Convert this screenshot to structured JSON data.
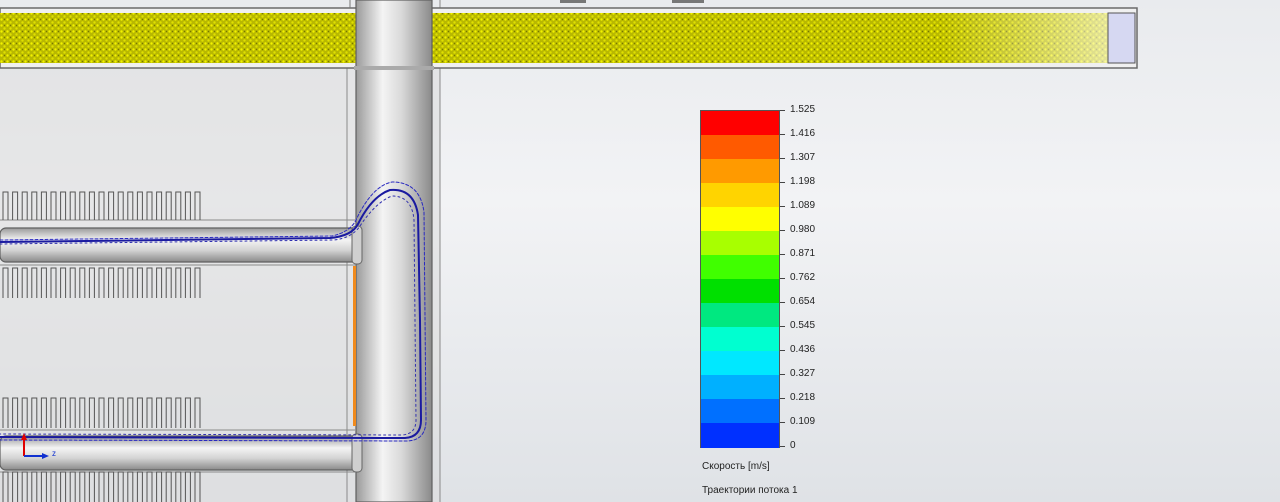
{
  "legend": {
    "title": "Скорость [m/s]",
    "ticks": [
      "1.525",
      "1.416",
      "1.307",
      "1.198",
      "1.089",
      "0.980",
      "0.871",
      "0.762",
      "0.654",
      "0.545",
      "0.436",
      "0.327",
      "0.218",
      "0.109",
      "0"
    ],
    "colors": [
      "#ff0000",
      "#ff5a00",
      "#ff9a00",
      "#ffd400",
      "#ffff00",
      "#a8ff00",
      "#40ff00",
      "#00e000",
      "#00e880",
      "#00ffd0",
      "#00e8ff",
      "#00b0ff",
      "#0070ff",
      "#0030ff",
      "#0000ff"
    ]
  },
  "trajectory_label": "Траектории потока 1",
  "axis_triad": {
    "z_label": "z"
  },
  "colors": {
    "trajectory": "#1a1aa0",
    "pipe_fill": "#c8c8c8",
    "particles": "#d6d600"
  }
}
